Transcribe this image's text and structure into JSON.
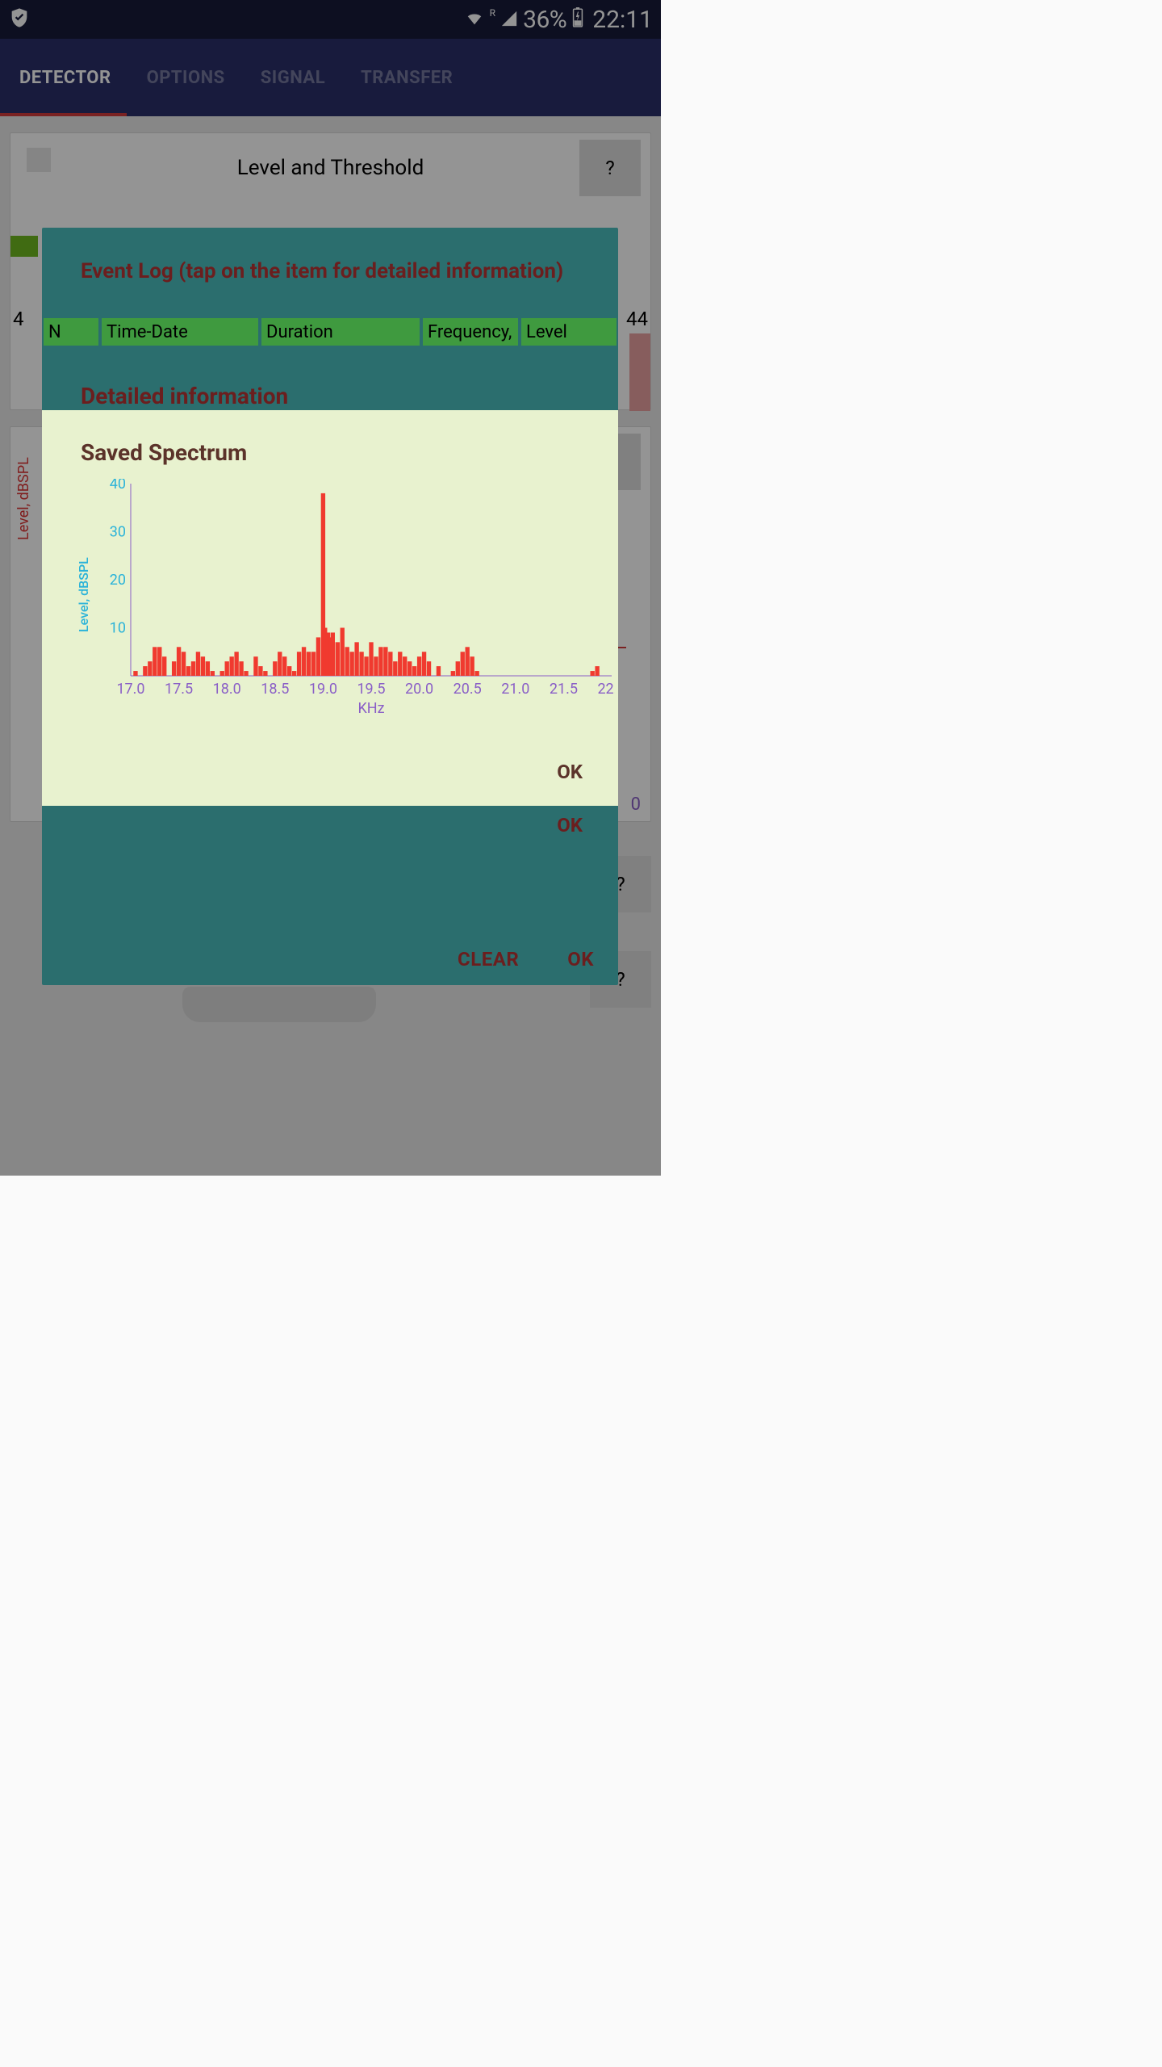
{
  "statusbar": {
    "battery_pct": "36%",
    "time": "22:11",
    "roaming": "R"
  },
  "tabs": [
    {
      "label": "DETECTOR",
      "active": true
    },
    {
      "label": "OPTIONS"
    },
    {
      "label": "SIGNAL"
    },
    {
      "label": "TRANSFER"
    }
  ],
  "card_level": {
    "title": "Level and Threshold",
    "help": "?",
    "left_tick": "4",
    "right_tick": "44"
  },
  "card_bg": {
    "ylabel": "Level, dBSPL",
    "help": "?",
    "value0": "0"
  },
  "help_lower": "?",
  "dialogs": {
    "outer": {
      "clear": "CLEAR",
      "ok": "OK"
    },
    "eventlog": {
      "title": "Event Log (tap on the item for detailed information)",
      "headers": {
        "n": "N",
        "timedate": "Time-Date",
        "duration": "Duration",
        "frequency": "Frequency,",
        "level": "Level"
      }
    },
    "mid": {
      "title": "Detailed information",
      "ok": "OK"
    },
    "spectrum": {
      "title": "Saved Spectrum",
      "ok": "OK",
      "ylabel": "Level, dBSPL",
      "xlabel": "KHz"
    }
  },
  "chart_data": {
    "type": "bar",
    "xlabel": "KHz",
    "ylabel": "Level, dBSPL",
    "ylim": [
      0,
      40
    ],
    "xlim": [
      17.0,
      22.0
    ],
    "x_ticks": [
      17.0,
      17.5,
      18.0,
      18.5,
      19.0,
      19.5,
      20.0,
      20.5,
      21.0,
      21.5,
      22.0
    ],
    "y_ticks": [
      10,
      20,
      30,
      40
    ],
    "x": [
      17.05,
      17.1,
      17.15,
      17.2,
      17.25,
      17.3,
      17.35,
      17.4,
      17.45,
      17.5,
      17.55,
      17.6,
      17.65,
      17.7,
      17.75,
      17.8,
      17.85,
      17.9,
      17.95,
      18.0,
      18.05,
      18.1,
      18.15,
      18.2,
      18.25,
      18.3,
      18.35,
      18.4,
      18.45,
      18.5,
      18.55,
      18.6,
      18.65,
      18.7,
      18.75,
      18.8,
      18.85,
      18.9,
      18.95,
      19.0,
      19.02,
      19.05,
      19.08,
      19.1,
      19.15,
      19.2,
      19.25,
      19.3,
      19.35,
      19.4,
      19.45,
      19.5,
      19.55,
      19.6,
      19.65,
      19.7,
      19.75,
      19.8,
      19.85,
      19.9,
      19.95,
      20.0,
      20.05,
      20.1,
      20.15,
      20.2,
      20.25,
      20.3,
      20.35,
      20.4,
      20.45,
      20.5,
      20.55,
      20.6,
      21.8,
      21.85
    ],
    "values": [
      1,
      0,
      2,
      3,
      6,
      6,
      4,
      0,
      3,
      6,
      5,
      2,
      3,
      5,
      4,
      3,
      1,
      0,
      1,
      3,
      4,
      5,
      3,
      1,
      0,
      4,
      2,
      1,
      0,
      3,
      5,
      4,
      2,
      1,
      5,
      6,
      5,
      5,
      8,
      38,
      10,
      9,
      8,
      9,
      7,
      10,
      6,
      5,
      7,
      5,
      4,
      7,
      4,
      6,
      6,
      5,
      3,
      5,
      4,
      3,
      2,
      4,
      5,
      3,
      0,
      2,
      0,
      0,
      1,
      3,
      5,
      6,
      4,
      1,
      1,
      2
    ]
  }
}
